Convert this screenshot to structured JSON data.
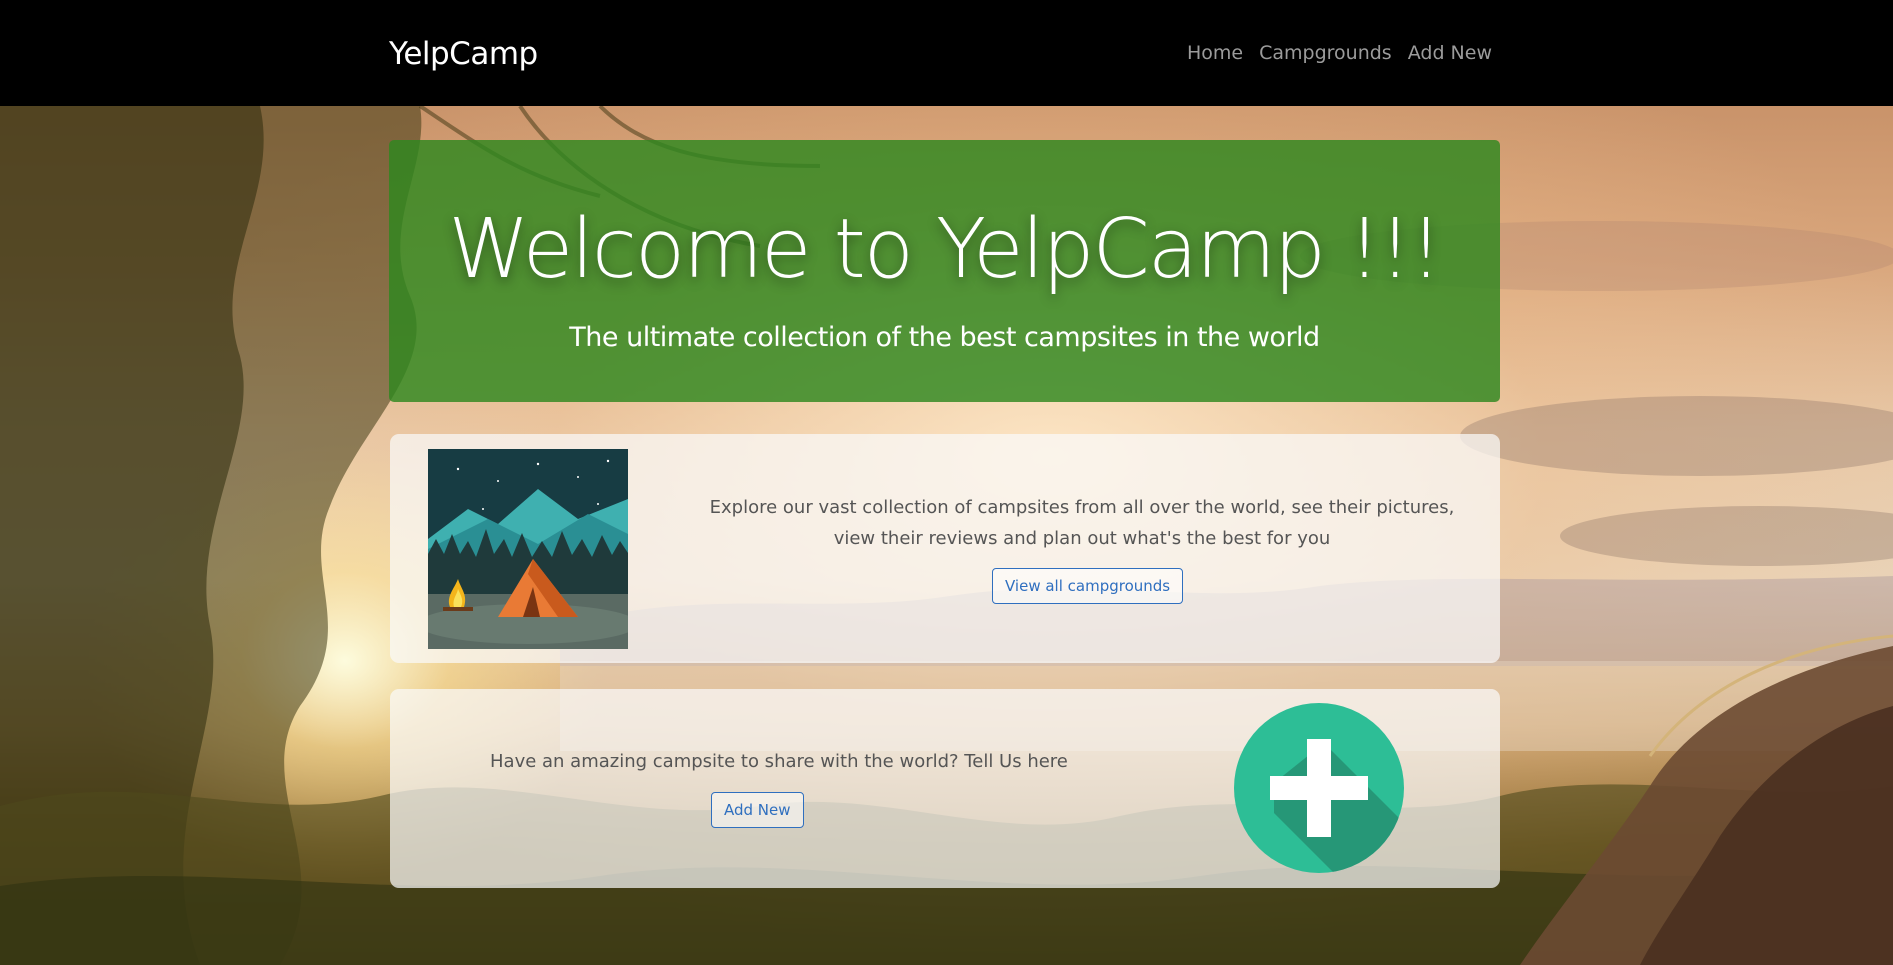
{
  "navbar": {
    "brand": "YelpCamp",
    "links": [
      "Home",
      "Campgrounds",
      "Add New"
    ]
  },
  "hero": {
    "title": "Welcome to YelpCamp !!!",
    "subtitle": "The ultimate collection of the best campsites in the world"
  },
  "explore_card": {
    "text": "Explore our vast collection of campsites from all over the world, see their pictures, view their reviews and plan out what's the best for you",
    "button": "View all campgrounds",
    "image_icon": "tent-campfire-illustration"
  },
  "add_card": {
    "text": "Have an amazing campsite to share with the world? Tell Us here",
    "button": "Add New",
    "image_icon": "plus-icon"
  },
  "colors": {
    "navbar_bg": "#000000",
    "jumbotron_bg": "#2e881e",
    "button_outline": "#2f6fbf",
    "plus_circle": "#2dbe96"
  }
}
